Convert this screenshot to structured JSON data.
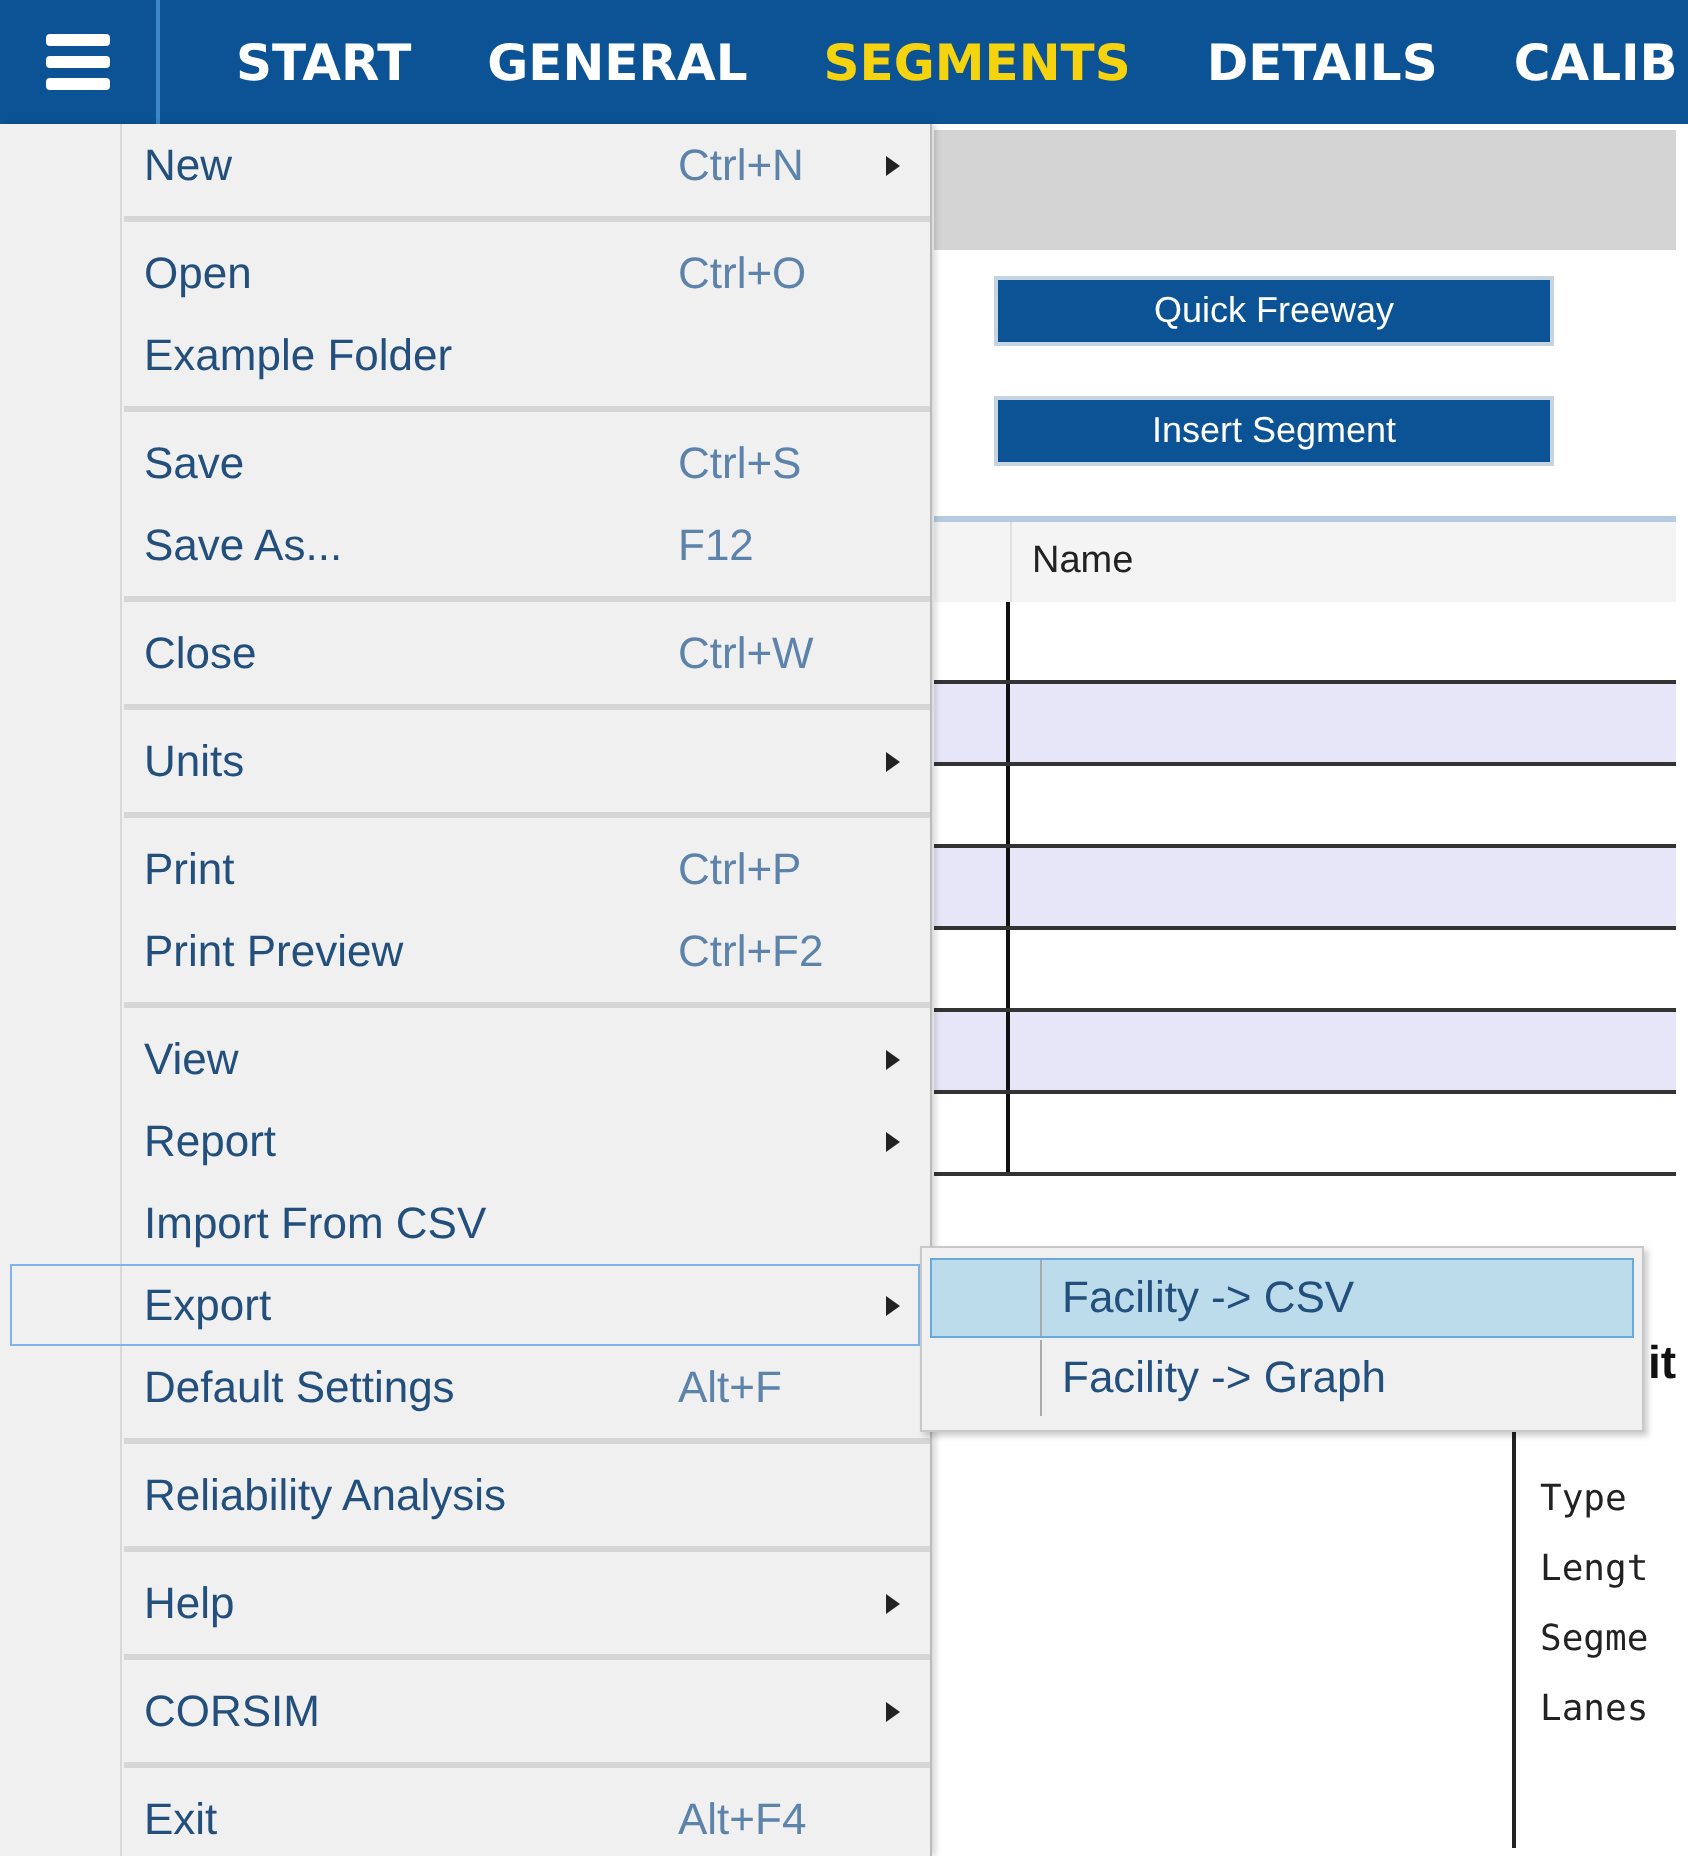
{
  "nav": {
    "tabs": [
      {
        "label": "START",
        "selected": false
      },
      {
        "label": "GENERAL",
        "selected": false
      },
      {
        "label": "SEGMENTS",
        "selected": true
      },
      {
        "label": "DETAILS",
        "selected": false
      },
      {
        "label": "CALIB",
        "selected": false
      }
    ]
  },
  "buttons": [
    "Quick Freeway",
    "Insert Segment"
  ],
  "table": {
    "columns": [
      "Name"
    ]
  },
  "details": {
    "heading": "it",
    "fields": [
      "Type",
      "Lengt",
      "Segme",
      "Lanes"
    ]
  },
  "menu": {
    "groups": [
      [
        {
          "label": "New",
          "shortcut": "Ctrl+N",
          "has_submenu": true,
          "selected": false
        }
      ],
      [
        {
          "label": "Open",
          "shortcut": "Ctrl+O",
          "has_submenu": false,
          "selected": false
        },
        {
          "label": "Example Folder",
          "has_submenu": false,
          "selected": false
        }
      ],
      [
        {
          "label": "Save",
          "shortcut": "Ctrl+S",
          "has_submenu": false,
          "selected": false
        },
        {
          "label": "Save As...",
          "shortcut": "F12",
          "has_submenu": false,
          "selected": false
        }
      ],
      [
        {
          "label": "Close",
          "shortcut": "Ctrl+W",
          "has_submenu": false,
          "selected": false
        }
      ],
      [
        {
          "label": "Units",
          "has_submenu": true,
          "selected": false
        }
      ],
      [
        {
          "label": "Print",
          "shortcut": "Ctrl+P",
          "has_submenu": false,
          "selected": false
        },
        {
          "label": "Print Preview",
          "shortcut": "Ctrl+F2",
          "has_submenu": false,
          "selected": false
        }
      ],
      [
        {
          "label": "View",
          "has_submenu": true,
          "selected": false
        },
        {
          "label": "Report",
          "has_submenu": true,
          "selected": false
        },
        {
          "label": "Import From CSV",
          "has_submenu": false,
          "selected": false
        },
        {
          "label": "Export",
          "has_submenu": true,
          "selected": true
        },
        {
          "label": "Default Settings",
          "shortcut": "Alt+F",
          "has_submenu": false,
          "selected": false
        }
      ],
      [
        {
          "label": "Reliability Analysis",
          "has_submenu": false,
          "selected": false
        }
      ],
      [
        {
          "label": "Help",
          "has_submenu": true,
          "selected": false
        }
      ],
      [
        {
          "label": "CORSIM",
          "has_submenu": true,
          "selected": false
        }
      ],
      [
        {
          "label": "Exit",
          "shortcut": "Alt+F4",
          "has_submenu": false,
          "selected": false
        }
      ]
    ]
  },
  "submenu": {
    "items": [
      {
        "label": "Facility -> CSV",
        "selected": true
      },
      {
        "label": "Facility -> Graph",
        "selected": false
      }
    ]
  }
}
